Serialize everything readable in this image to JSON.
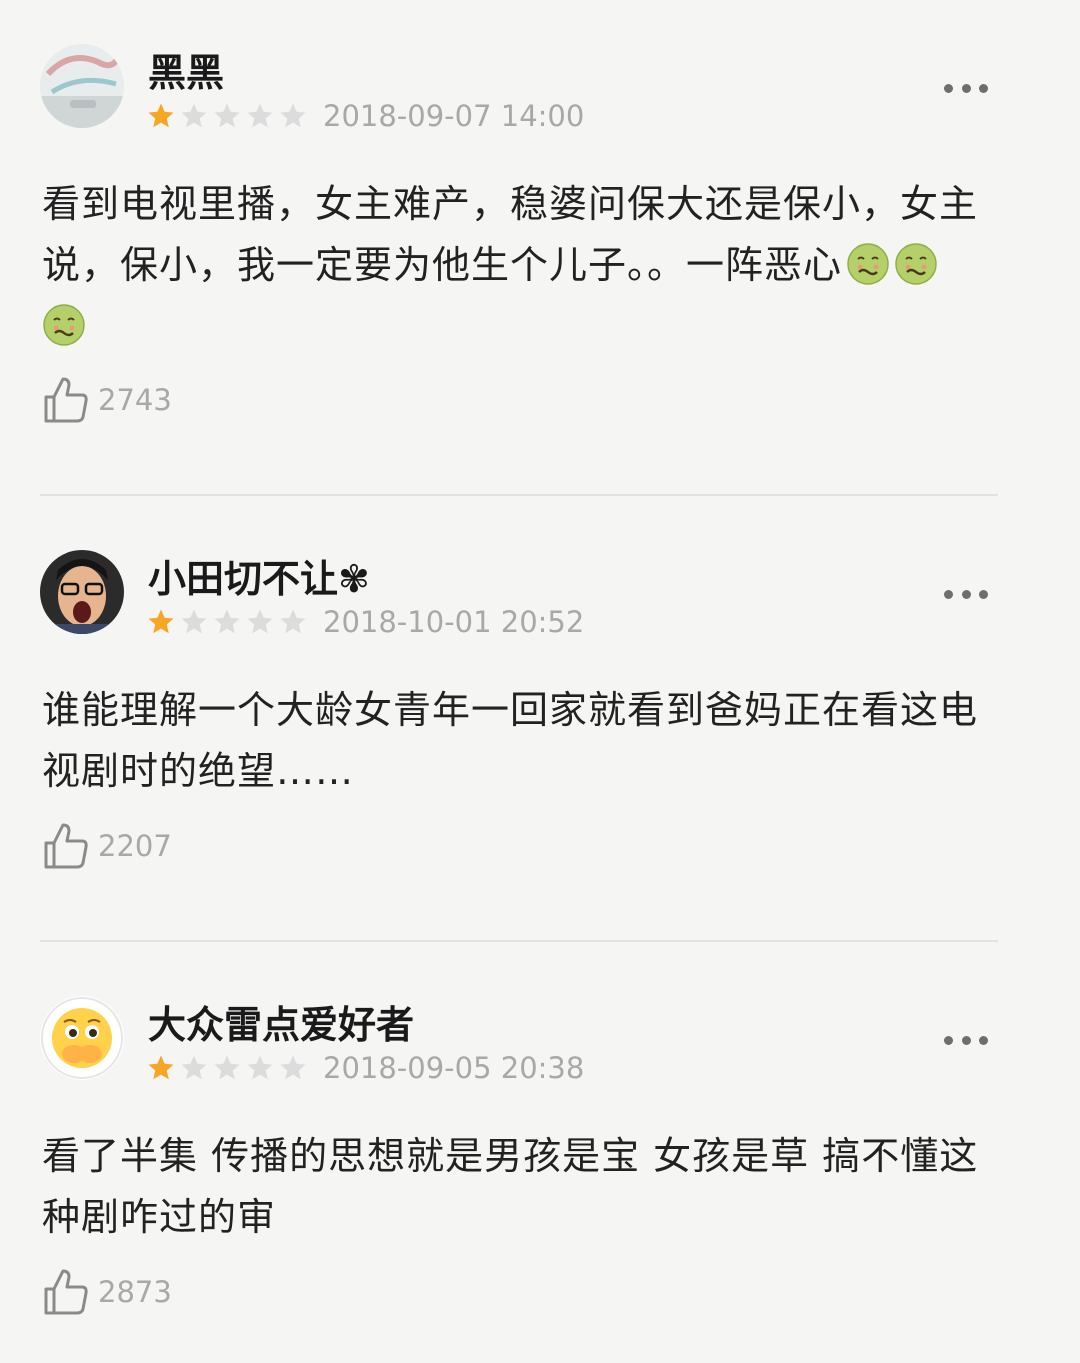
{
  "comments": [
    {
      "username": "黑黑",
      "rating": 1,
      "max_rating": 5,
      "date": "2018-09-07 14:00",
      "content": "看到电视里播，女主难产，稳婆问保大还是保小，女主说，保小，我一定要为他生个儿子。。一阵恶心",
      "emoji_count": 3,
      "likes": "2743"
    },
    {
      "username": "小田切不让",
      "username_suffix": "✾",
      "rating": 1,
      "max_rating": 5,
      "date": "2018-10-01 20:52",
      "content": "谁能理解一个大龄女青年一回家就看到爸妈正在看这电视剧时的绝望……",
      "likes": "2207"
    },
    {
      "username": "大众雷点爱好者",
      "rating": 1,
      "max_rating": 5,
      "date": "2018-09-05 20:38",
      "content": "看了半集 传播的思想就是男孩是宝 女孩是草 搞不懂这种剧咋过的审",
      "likes": "2873"
    }
  ],
  "colors": {
    "star_filled": "#f5a623",
    "star_empty": "#dcdcdc",
    "background": "#f5f5f3",
    "muted_text": "#a8a8a8"
  },
  "icons": {
    "like": "thumbs-up-icon",
    "more": "more-dots-icon",
    "emoji": "nauseated-face-icon"
  }
}
